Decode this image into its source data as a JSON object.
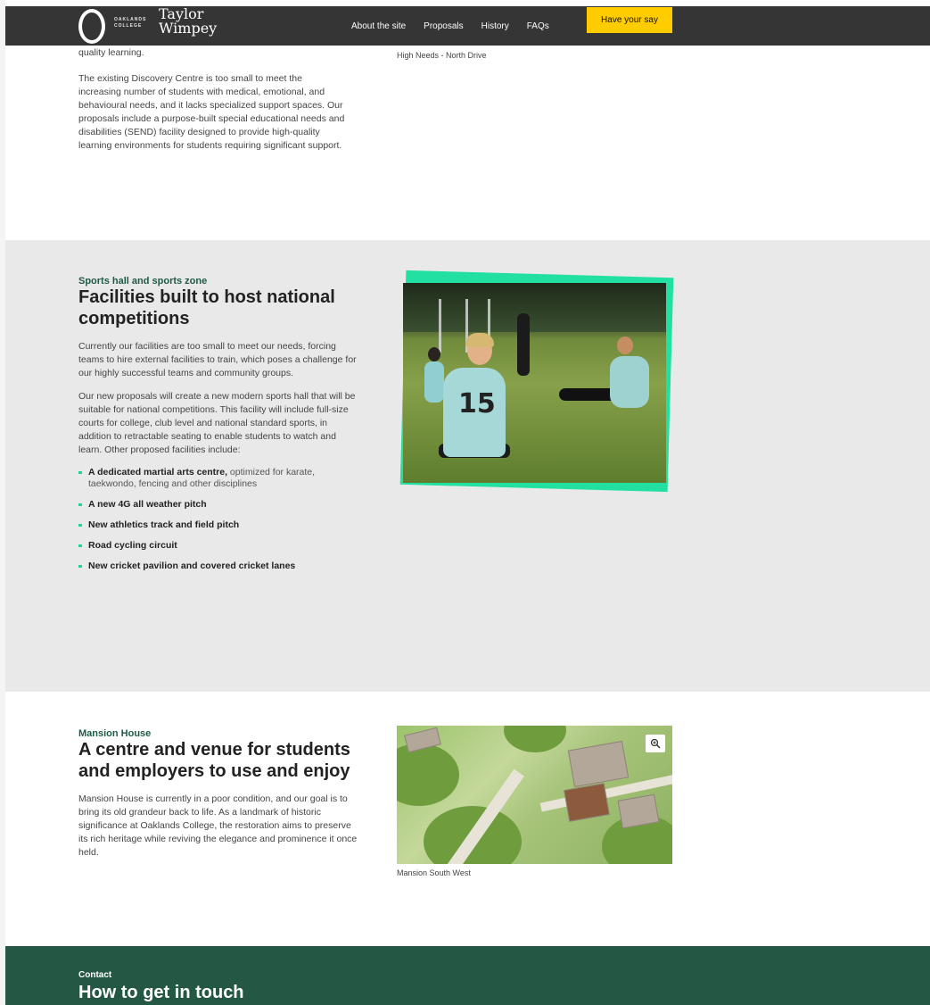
{
  "header": {
    "logo_college": "OAKLANDS COLLEGE",
    "logo_tw": "Taylor Wimpey",
    "nav": [
      "About the site",
      "Proposals",
      "History",
      "FAQs"
    ],
    "cta": "Have your say"
  },
  "section_discovery": {
    "paragraph_top": "quality learning.",
    "paragraph": "The existing Discovery Centre is too small to meet the increasing number of students with medical, emotional, and behavioural needs, and it lacks specialized support spaces. Our proposals include a purpose-built special educational needs and disabilities (SEND) facility designed to provide high-quality learning environments for students requiring significant support.",
    "caption": "High Needs - North Drive"
  },
  "section_sports": {
    "eyebrow": "Sports hall and sports zone",
    "heading": "Facilities built to host national competitions",
    "paragraph_1": "Currently our facilities are too small to meet our needs, forcing teams to hire external facilities to train, which poses a challenge for our highly successful teams and community groups.",
    "paragraph_2": "Our new proposals will create a new modern sports hall that will be suitable for national competitions. This facility will include full-size courts for college, club level and national standard sports, in addition to retractable seating to enable students to watch and learn. Other proposed facilities include:",
    "bullets": [
      {
        "bold": "A dedicated martial arts centre,",
        "rest": " optimized for karate, taekwondo, fencing and other disciplines"
      },
      {
        "bold": "A new 4G all weather pitch",
        "rest": ""
      },
      {
        "bold": "New athletics track and field pitch",
        "rest": ""
      },
      {
        "bold": "Road cycling circuit",
        "rest": ""
      },
      {
        "bold": "New cricket pavilion and covered cricket lanes",
        "rest": ""
      }
    ],
    "photo": {
      "shirt_number": "15",
      "accent_color": "#22e0a1"
    }
  },
  "section_mansion": {
    "eyebrow": "Mansion House",
    "heading": "A centre and venue for students and employers to use and enjoy",
    "paragraph": "Mansion House is currently in a poor condition, and our goal is to bring its old grandeur back to life. As a landmark of historic significance at Oaklands College, the restoration aims to preserve its rich heritage while reviving the elegance and prominence it once held.",
    "caption": "Mansion South West",
    "zoom_icon": "magnifier-plus-icon"
  },
  "contact": {
    "eyebrow": "Contact",
    "heading": "How to get in touch"
  },
  "colors": {
    "header_bg": "#353535",
    "cta_bg": "#ffcc00",
    "section_alt_bg": "#e9e9e9",
    "eyebrow": "#1e5a45",
    "bullet_marker": "#1fd39a",
    "contact_bg": "#245845"
  }
}
